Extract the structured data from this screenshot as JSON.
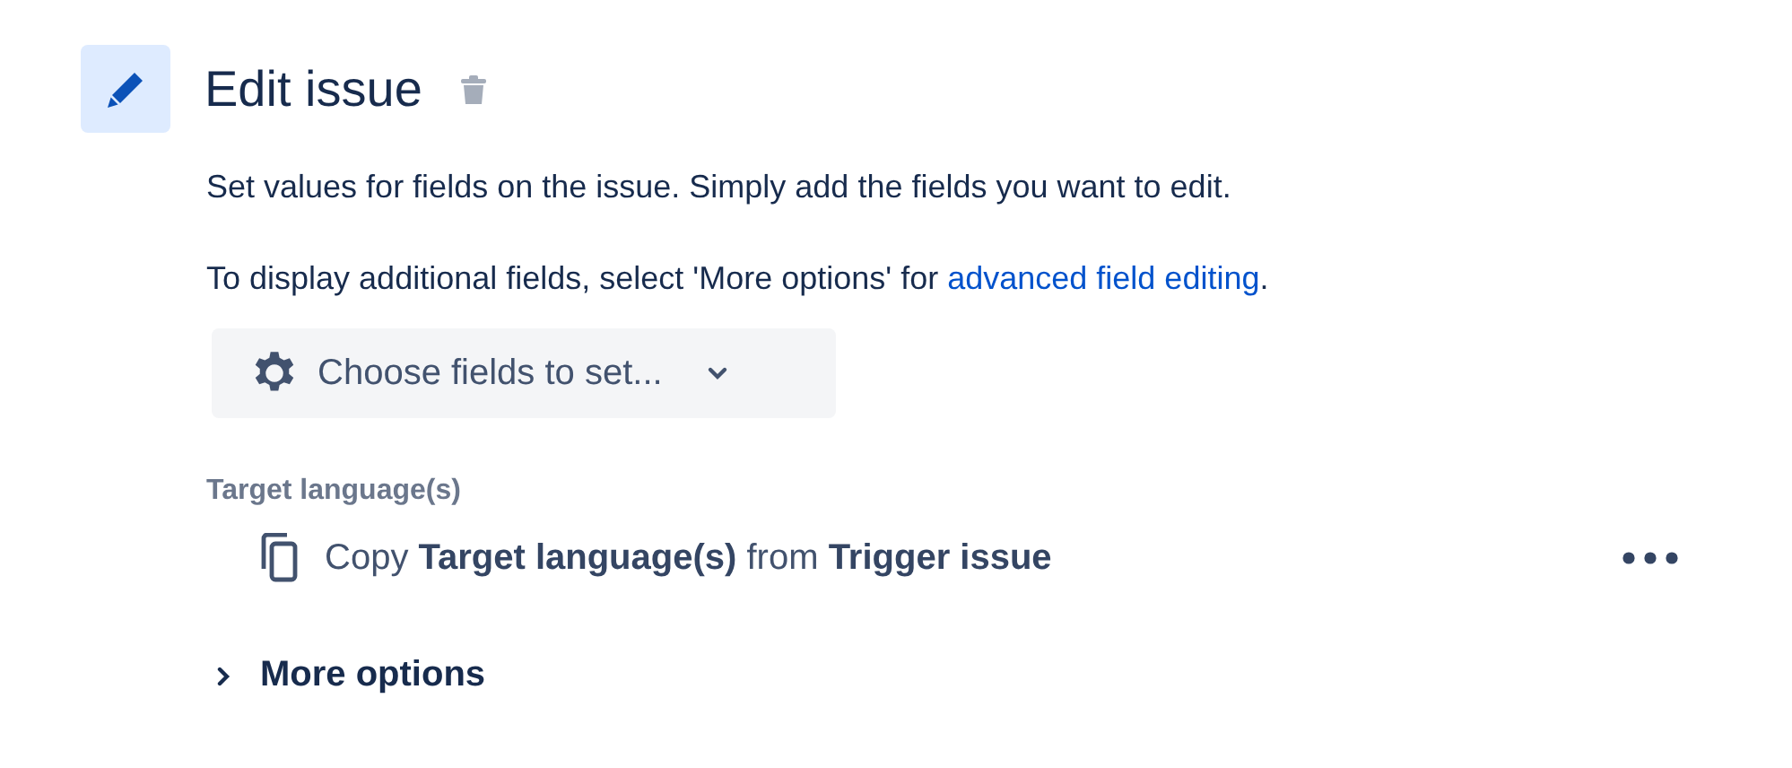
{
  "header": {
    "title": "Edit issue"
  },
  "description": [
    "Set values for fields on the issue. Simply add the fields you want to edit.",
    "To display additional fields, select 'More options' for "
  ],
  "link": {
    "label": "advanced field editing",
    "after": "."
  },
  "choose_button": {
    "label": "Choose fields to set..."
  },
  "field": {
    "label": "Target language(s)",
    "value": "Copy **Target language(s)** from **Trigger issue**"
  },
  "more_options": {
    "label": "More options",
    "expanded": false
  }
}
